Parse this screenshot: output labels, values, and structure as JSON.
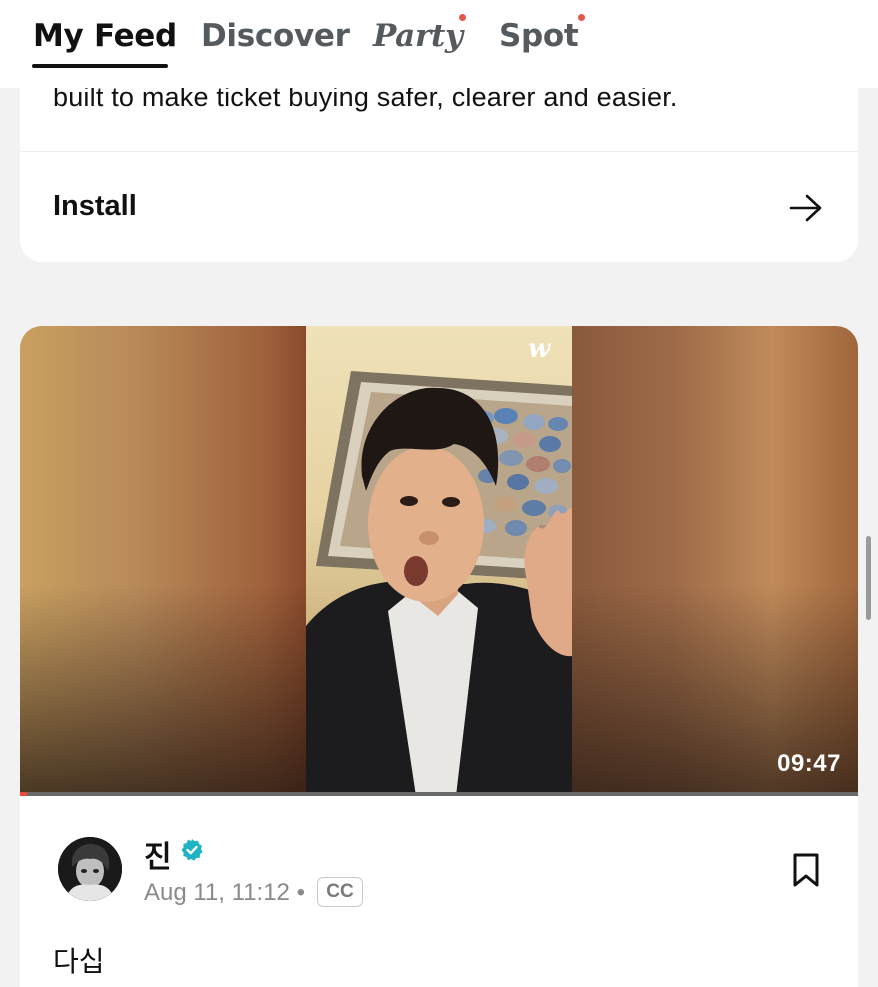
{
  "tabs": {
    "my_feed": "My Feed",
    "discover": "Discover",
    "party": "Party",
    "spot": "Spot",
    "active": "my_feed",
    "notification_dot_color": "#e2574c"
  },
  "promo": {
    "text": "built to make ticket buying safer, clearer and easier.",
    "install_label": "Install",
    "install_icon": "arrow-right-icon"
  },
  "video": {
    "logo": "w",
    "duration": "09:47",
    "progress_fraction": 0.008,
    "progress_color": "#e84a3c"
  },
  "post": {
    "author": "진",
    "verified_icon": "verified-badge-icon",
    "verified_color": "#1fb3c4",
    "date": "Aug 11, 11:12",
    "separator": "•",
    "cc_label": "CC",
    "bookmark_icon": "bookmark-icon",
    "text": "다십"
  }
}
